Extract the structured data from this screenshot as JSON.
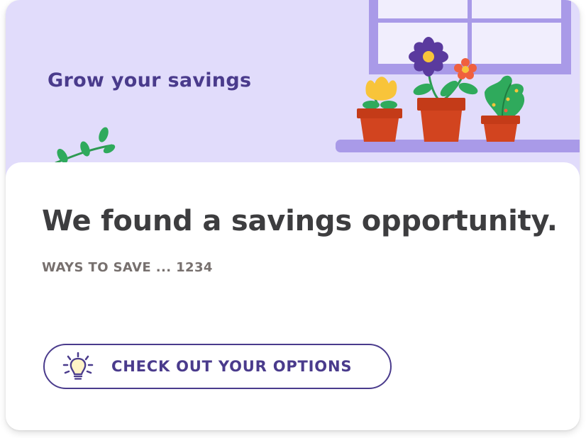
{
  "banner": {
    "title": "Grow your savings"
  },
  "card": {
    "headline": "We found a savings opportunity.",
    "subhead": "WAYS TO SAVE ... 1234",
    "cta": {
      "label": "CHECK OUT YOUR OPTIONS",
      "icon": "lightbulb-icon"
    }
  },
  "colors": {
    "banner_bg": "#e1dcfb",
    "accent": "#4a3b8c",
    "headline": "#3d3d3f",
    "subhead": "#77706e",
    "pot": "#d2441f",
    "leaf": "#2faa5c"
  }
}
